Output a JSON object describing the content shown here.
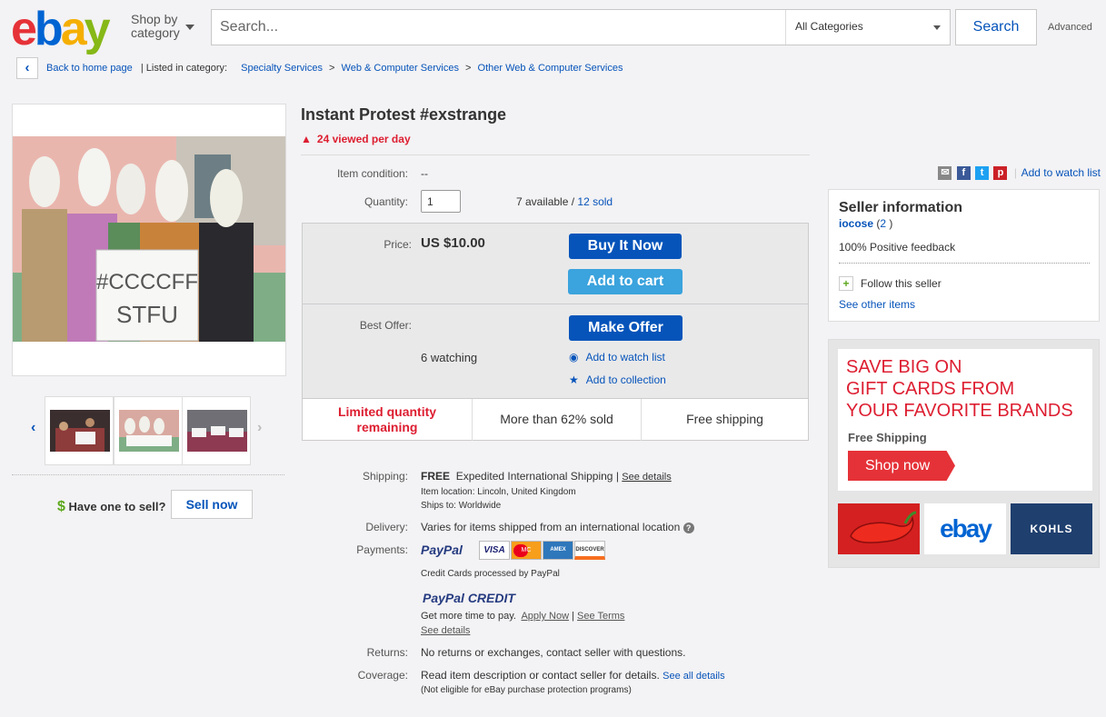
{
  "header": {
    "logo_letters": [
      "e",
      "b",
      "a",
      "y"
    ],
    "logo_colors": [
      "#e53238",
      "#0064d2",
      "#f5af02",
      "#86b817"
    ],
    "shop_by_line1": "Shop by",
    "shop_by_line2": "category",
    "search_placeholder": "Search...",
    "category_select": "All Categories",
    "search_button": "Search",
    "advanced_link": "Advanced"
  },
  "breadcrumb": {
    "back_link": "Back to home page",
    "listed_in": "| Listed in category:",
    "items": [
      "Specialty Services",
      "Web & Computer Services",
      "Other Web & Computer Services"
    ],
    "separator": ">"
  },
  "gallery": {
    "photo_sign_line1": "#CCCCFF",
    "photo_sign_line2": "STFU",
    "thumb_count": 3
  },
  "sell": {
    "dollar": "$",
    "have_one": "Have one to sell?",
    "sell_now": "Sell now"
  },
  "item": {
    "title": "Instant Protest #exstrange",
    "viewed_per_day": "24 viewed per day",
    "condition_label": "Item condition:",
    "condition_value": "--",
    "quantity_label": "Quantity:",
    "quantity_value": "1",
    "available_text": "7 available /",
    "sold_link": "12 sold"
  },
  "price_panel": {
    "price_label": "Price:",
    "price_value": "US $10.00",
    "buy_it_now": "Buy It Now",
    "add_to_cart": "Add to cart",
    "best_offer_label": "Best Offer:",
    "make_offer": "Make Offer",
    "watching": "6 watching",
    "add_watch": "Add to watch list",
    "add_collection": "Add to collection",
    "strip": [
      "Limited quantity remaining",
      "More than 62% sold",
      "Free shipping"
    ],
    "accent_red": "#dd1e31"
  },
  "details": {
    "shipping_label": "Shipping:",
    "shipping_free": "FREE",
    "shipping_value": "Expedited International Shipping |",
    "see_details": "See details",
    "item_location": "Item location:  Lincoln, United Kingdom",
    "ships_to": "Ships to:  Worldwide",
    "delivery_label": "Delivery:",
    "delivery_value": "Varies for items shipped from an international location",
    "payments_label": "Payments:",
    "paypal": "PayPal",
    "cards": [
      "VISA",
      "MC",
      "AMEX",
      "DISCOVER"
    ],
    "credit_note": "Credit Cards processed by PayPal",
    "paypal_credit": "PayPal CREDIT",
    "credit_more_time": "Get more time to pay.",
    "apply_now": "Apply Now",
    "see_terms": "See Terms",
    "see_details2": "See details",
    "returns_label": "Returns:",
    "returns_value": "No returns or exchanges, contact seller with questions.",
    "coverage_label": "Coverage:",
    "coverage_value": "Read item description or contact seller for details.",
    "see_all_details": "See all details",
    "not_eligible": "(Not eligible for eBay purchase protection programs)"
  },
  "share": {
    "add_to_watch_list": "Add to watch list",
    "icons": [
      "email-icon",
      "facebook-icon",
      "twitter-icon",
      "pinterest-icon"
    ]
  },
  "seller": {
    "heading": "Seller information",
    "name": "iocose",
    "score": "2",
    "feedback": "100% Positive feedback",
    "follow": "Follow this seller",
    "see_other": "See other items"
  },
  "ad": {
    "line1": "SAVE BIG ON",
    "line2": "GIFT CARDS FROM",
    "line3": "YOUR FAVORITE BRANDS",
    "free_shipping": "Free Shipping",
    "shop_now": "Shop now",
    "card_ebay": "ebay",
    "card_kohls": "KOHLS"
  }
}
